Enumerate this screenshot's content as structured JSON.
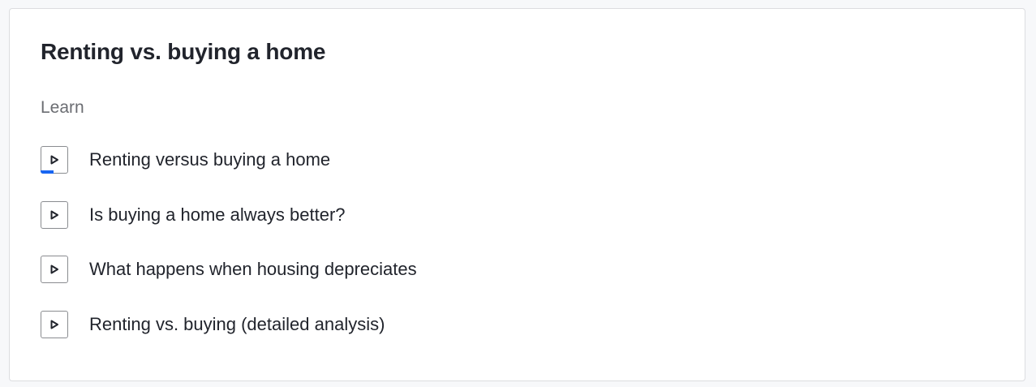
{
  "card": {
    "title": "Renting vs. buying a home",
    "section_label": "Learn"
  },
  "lessons": [
    {
      "label": "Renting versus buying a home",
      "icon": "play-icon",
      "progress": 0.5
    },
    {
      "label": "Is buying a home always better?",
      "icon": "play-icon",
      "progress": 0
    },
    {
      "label": "What happens when housing depreciates",
      "icon": "play-icon",
      "progress": 0
    },
    {
      "label": "Renting vs. buying (detailed analysis)",
      "icon": "play-icon",
      "progress": 0
    }
  ],
  "colors": {
    "progress": "#1865f2",
    "text": "#21242c",
    "muted": "#6b6d72",
    "border": "#8a8c90"
  }
}
